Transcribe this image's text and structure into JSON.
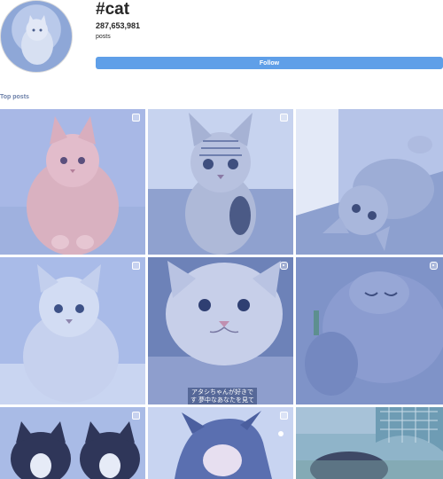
{
  "header": {
    "hashtag": "#cat",
    "post_count": "287,653,981",
    "post_label": "posts",
    "follow_label": "Follow"
  },
  "section": {
    "title": "Top posts"
  },
  "tiles": [
    {
      "name": "post-orange-cat",
      "icon": "multi-photo-icon"
    },
    {
      "name": "post-tabby-kitten",
      "icon": "multi-photo-icon"
    },
    {
      "name": "post-lying-kitten",
      "icon": "none"
    },
    {
      "name": "post-fluffy-kitten",
      "icon": "multi-photo-icon"
    },
    {
      "name": "post-closeup-kitten",
      "icon": "reel-icon",
      "caption": "アタシちゃんが好きです 夢中なあなたを見て❤"
    },
    {
      "name": "post-gray-cat",
      "icon": "reel-icon"
    },
    {
      "name": "post-tuxedo-kittens",
      "icon": "multi-photo-icon"
    },
    {
      "name": "post-illustration",
      "icon": "multi-photo-icon"
    },
    {
      "name": "post-outdoor-cat",
      "icon": "none"
    }
  ],
  "colors": {
    "accent": "#5f9fe8",
    "tint": "#8ea7d7"
  }
}
